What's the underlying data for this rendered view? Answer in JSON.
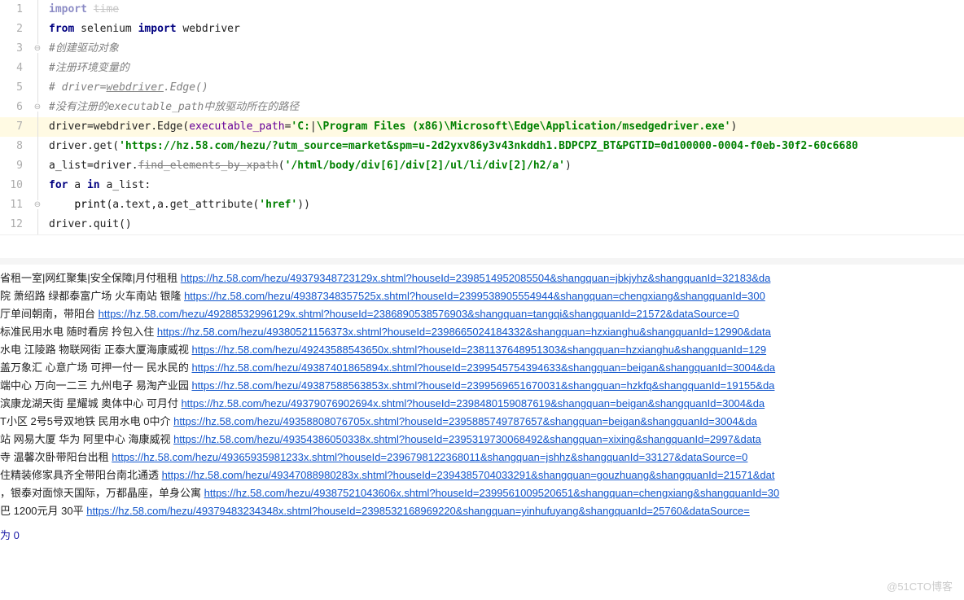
{
  "code": {
    "lines": [
      {
        "n": "1",
        "fold": "",
        "indent": "",
        "tokens": [
          {
            "c": "kw",
            "t": "import"
          },
          {
            "c": "",
            "t": " "
          },
          {
            "c": "strike",
            "t": "time"
          }
        ],
        "dim": true
      },
      {
        "n": "2",
        "fold": "",
        "indent": "",
        "tokens": [
          {
            "c": "kw",
            "t": "from"
          },
          {
            "c": "",
            "t": " selenium "
          },
          {
            "c": "kw",
            "t": "import"
          },
          {
            "c": "",
            "t": " webdriver"
          }
        ]
      },
      {
        "n": "3",
        "fold": "⊖",
        "indent": "",
        "tokens": [
          {
            "c": "cm",
            "t": "#创建驱动对象"
          }
        ]
      },
      {
        "n": "4",
        "fold": "",
        "indent": "",
        "tokens": [
          {
            "c": "cm",
            "t": "#注册环境变量的"
          }
        ]
      },
      {
        "n": "5",
        "fold": "",
        "indent": "",
        "tokens": [
          {
            "c": "cm",
            "t": "# driver="
          },
          {
            "c": "underline",
            "t": "webdriver"
          },
          {
            "c": "cm",
            "t": ".Edge()"
          }
        ]
      },
      {
        "n": "6",
        "fold": "⊖",
        "indent": "",
        "tokens": [
          {
            "c": "cm",
            "t": "#没有注册的executable_path中放驱动所在的路径"
          }
        ]
      },
      {
        "n": "7",
        "fold": "",
        "indent": "",
        "hl": true,
        "tokens": [
          {
            "c": "",
            "t": "driver=webdriver.Edge("
          },
          {
            "c": "param",
            "t": "executable_path"
          },
          {
            "c": "",
            "t": "="
          },
          {
            "c": "str",
            "t": "'C:"
          },
          {
            "c": "",
            "t": "|"
          },
          {
            "c": "str",
            "t": "\\Program Files (x86)\\Microsoft\\Edge\\Application/msedgedriver.exe'"
          },
          {
            "c": "",
            "t": ")"
          }
        ]
      },
      {
        "n": "8",
        "fold": "",
        "indent": "",
        "tokens": [
          {
            "c": "",
            "t": "driver.get("
          },
          {
            "c": "str",
            "t": "'https://hz.58.com/hezu/?utm_source=market&spm=u-2d2yxv86y3v43nkddh1.BDPCPZ_BT&PGTID=0d100000-0004-f0eb-30f2-60c6680"
          },
          {
            "c": "",
            "t": ""
          }
        ]
      },
      {
        "n": "9",
        "fold": "",
        "indent": "",
        "tokens": [
          {
            "c": "",
            "t": "a_list=driver."
          },
          {
            "c": "strike",
            "t": "find_elements_by_xpath"
          },
          {
            "c": "",
            "t": "("
          },
          {
            "c": "str",
            "t": "'/html/body/div[6]/div[2]/ul/li/div[2]/h2/a'"
          },
          {
            "c": "",
            "t": ")"
          }
        ]
      },
      {
        "n": "10",
        "fold": "",
        "indent": "",
        "tokens": [
          {
            "c": "kw",
            "t": "for"
          },
          {
            "c": "",
            "t": " a "
          },
          {
            "c": "kw",
            "t": "in"
          },
          {
            "c": "",
            "t": " a_list:"
          }
        ]
      },
      {
        "n": "11",
        "fold": "⊖",
        "indent": "    ",
        "tokens": [
          {
            "c": "fn",
            "t": "print"
          },
          {
            "c": "",
            "t": "(a.text,a.get_attribute("
          },
          {
            "c": "str",
            "t": "'href'"
          },
          {
            "c": "",
            "t": "))"
          }
        ]
      },
      {
        "n": "12",
        "fold": "",
        "indent": "",
        "tokens": [
          {
            "c": "",
            "t": "driver.quit()"
          }
        ]
      }
    ]
  },
  "console": {
    "lines": [
      {
        "text": "省租一室|网红聚集|安全保障|月付租租 ",
        "url": "https://hz.58.com/hezu/49379348723129x.shtml?houseId=2398514952085504&shangquan=jbkjyhz&shangquanId=32183&da"
      },
      {
        "text": "院 萧绍路 绿都泰富广场 火车南站 银隆 ",
        "url": "https://hz.58.com/hezu/49387348357525x.shtml?houseId=2399538905554944&shangquan=chengxiang&shangquanId=300"
      },
      {
        "text": "厅单间朝南，带阳台 ",
        "url": "https://hz.58.com/hezu/49288532996129x.shtml?houseId=2386890538576903&shangquan=tangqi&shangquanId=21572&dataSource=0"
      },
      {
        "text": "标准民用水电 随时看房 拎包入住 ",
        "url": "https://hz.58.com/hezu/49380521156373x.shtml?houseId=2398665024184332&shangquan=hzxianghu&shangquanId=12990&data"
      },
      {
        "text": "水电 江陵路 物联网街 正泰大厦海康威视 ",
        "url": "https://hz.58.com/hezu/49243588543650x.shtml?houseId=2381137648951303&shangquan=hzxianghu&shangquanId=129"
      },
      {
        "text": "盖万象汇 心意广场 可押一付一 民水民的 ",
        "url": "https://hz.58.com/hezu/49387401865894x.shtml?houseId=2399545754394633&shangquan=beigan&shangquanId=3004&da"
      },
      {
        "text": "端中心 万向一二三 九州电子 易淘产业园 ",
        "url": "https://hz.58.com/hezu/49387588563853x.shtml?houseId=2399569651670031&shangquan=hzkfq&shangquanId=19155&da"
      },
      {
        "text": " 滨康龙湖天街 星耀城 奥体中心 可月付 ",
        "url": "https://hz.58.com/hezu/49379076902694x.shtml?houseId=2398480159087619&shangquan=beigan&shangquanId=3004&da"
      },
      {
        "text": "T小区 2号5号双地铁 民用水电 0中介 ",
        "url": "https://hz.58.com/hezu/49358808076705x.shtml?houseId=2395885749787657&shangquan=beigan&shangquanId=3004&da"
      },
      {
        "text": "站 网易大厦 华为 阿里中心 海康威视 ",
        "url": "https://hz.58.com/hezu/49354386050338x.shtml?houseId=2395319730068492&shangquan=xixing&shangquanId=2997&data"
      },
      {
        "text": "寺 温馨次卧带阳台出租 ",
        "url": "https://hz.58.com/hezu/49365935981233x.shtml?houseId=2396798122368011&shangquan=jshhz&shangquanId=33127&dataSource=0"
      },
      {
        "text": "住精装修家具齐全带阳台南北通透 ",
        "url": "https://hz.58.com/hezu/49347088980283x.shtml?houseId=2394385704033291&shangquan=gouzhuang&shangquanId=21571&dat"
      },
      {
        "text": "，银泰对面惊天国际，万都晶座，单身公寓 ",
        "url": "https://hz.58.com/hezu/49387521043606x.shtml?houseId=2399561009520651&shangquan=chengxiang&shangquanId=30"
      },
      {
        "text": "巴 1200元月 30平 ",
        "url": "https://hz.58.com/hezu/49379483234348x.shtml?houseId=2398532168969220&shangquan=yinhufuyang&shangquanId=25760&dataSource="
      }
    ]
  },
  "status": {
    "label": "为 ",
    "value": "0"
  },
  "watermark": "@51CTO博客"
}
